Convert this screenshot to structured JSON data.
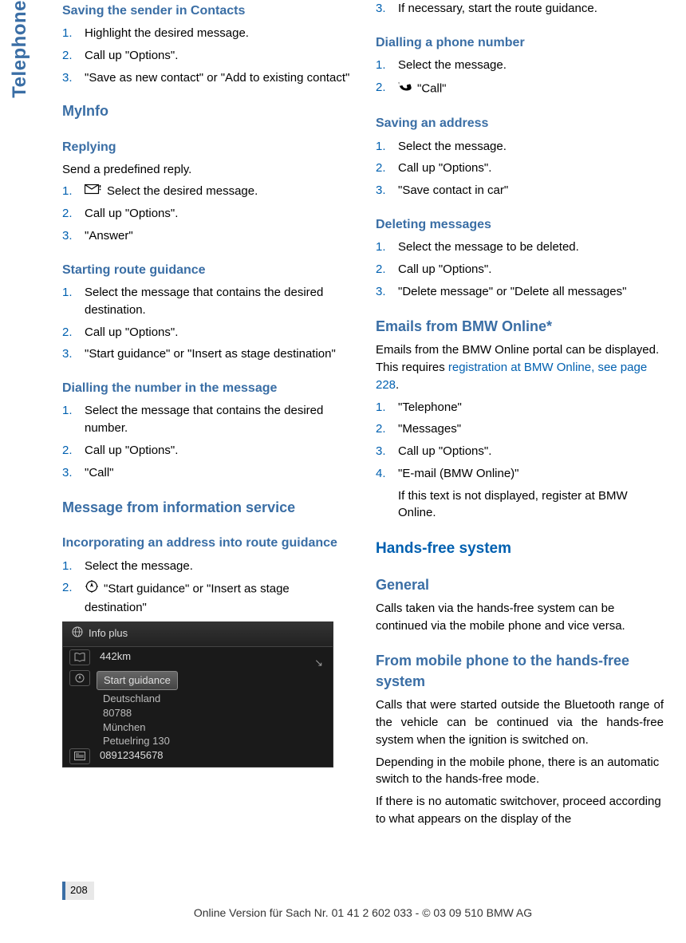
{
  "sideTab": "Telephone",
  "pageNumber": "208",
  "footerLine": "Online Version für Sach Nr. 01 41 2 602 033 - © 03 09 510 BMW AG",
  "left": {
    "sec1": {
      "title": "Saving the sender in Contacts",
      "items": [
        "Highlight the desired message.",
        "Call up \"Options\".",
        "\"Save as new contact\" or \"Add to existing contact\""
      ]
    },
    "myinfo": "MyInfo",
    "replying": {
      "title": "Replying",
      "intro": "Send a predefined reply.",
      "items": [
        "Select the desired message.",
        "Call up \"Options\".",
        "\"Answer\""
      ]
    },
    "route": {
      "title": "Starting route guidance",
      "items": [
        "Select the message that contains the desired destination.",
        "Call up \"Options\".",
        "\"Start guidance\" or \"Insert as stage destination\""
      ]
    },
    "dialnum": {
      "title": "Dialling the number in the message",
      "items": [
        "Select the message that contains the desired number.",
        "Call up \"Options\".",
        "\"Call\""
      ]
    },
    "infoservice": "Message from information service",
    "incorporate": {
      "title": "Incorporating an address into route guidance",
      "items": [
        "Select the message.",
        "\"Start guidance\" or \"Insert as stage destination\""
      ]
    },
    "screenshot": {
      "header": "Info plus",
      "distance": "442km",
      "highlight": "Start guidance",
      "line1": "Deutschland",
      "line2": "80788",
      "line3": "München",
      "line4": "Petuelring 130",
      "line5": "08912345678"
    }
  },
  "right": {
    "item3": "If necessary, start the route guidance.",
    "dialphone": {
      "title": "Dialling a phone number",
      "items": [
        "Select the message.",
        "\"Call\""
      ]
    },
    "saveaddr": {
      "title": "Saving an address",
      "items": [
        "Select the message.",
        "Call up \"Options\".",
        "\"Save contact in car\""
      ]
    },
    "delmsg": {
      "title": "Deleting messages",
      "items": [
        "Select the message to be deleted.",
        "Call up \"Options\".",
        "\"Delete message\" or \"Delete all messages\""
      ]
    },
    "emails": {
      "title": "Emails from BMW Online*",
      "intro1": "Emails from the BMW Online portal can be displayed. This requires ",
      "link": "registration at BMW Online, see page 228",
      "intro2": ".",
      "items": [
        "\"Telephone\"",
        "\"Messages\"",
        "Call up \"Options\".",
        "\"E-mail (BMW Online)\""
      ],
      "note": "If this text is not displayed, register at BMW Online."
    },
    "handsfree": "Hands-free system",
    "general": {
      "title": "General",
      "text": "Calls taken via the hands-free system can be continued via the mobile phone and vice versa."
    },
    "frommobile": {
      "title": "From mobile phone to the hands-free system",
      "p1": "Calls that were started outside the Bluetooth range of the vehicle can be continued via the hands-free system when the ignition is switched on.",
      "p2": "Depending in the mobile phone, there is an automatic switch to the hands-free mode.",
      "p3": "If there is no automatic switchover, proceed according to what appears on the display of the"
    }
  }
}
